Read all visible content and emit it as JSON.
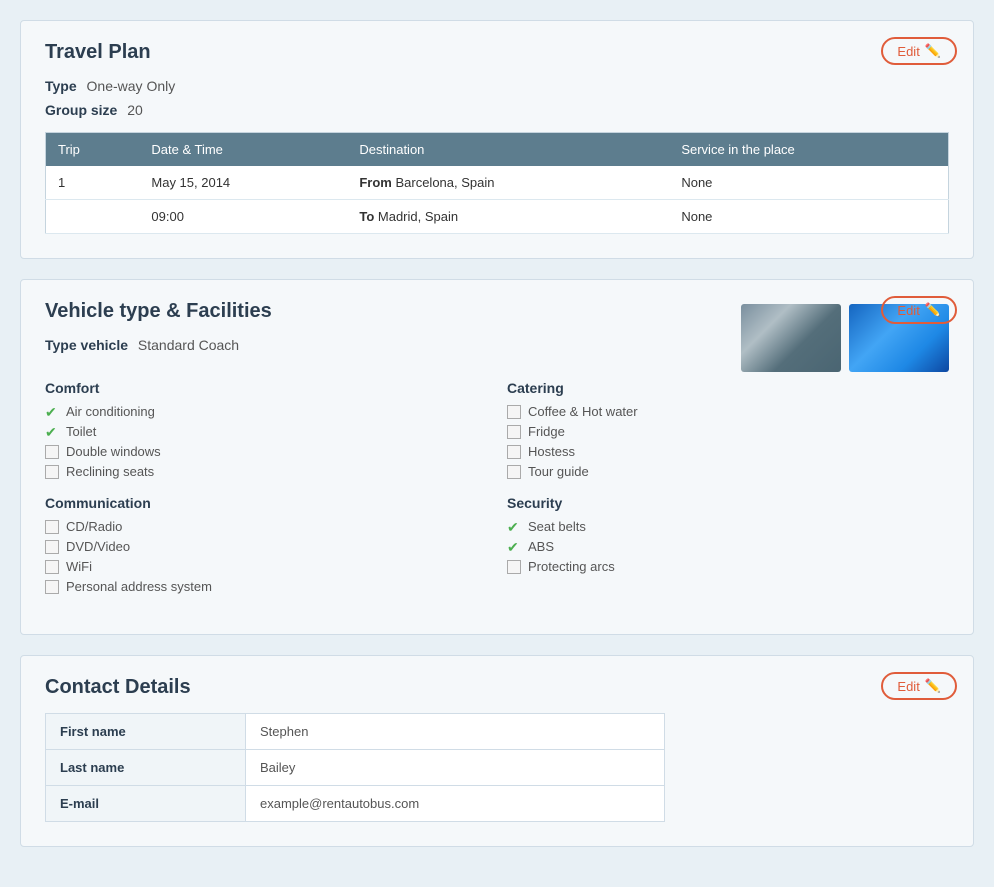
{
  "travelPlan": {
    "title": "Travel Plan",
    "editLabel": "Edit",
    "typeLabel": "Type",
    "typeValue": "One-way Only",
    "groupSizeLabel": "Group size",
    "groupSizeValue": "20",
    "table": {
      "headers": [
        "Trip",
        "Date & Time",
        "Destination",
        "Service in the place"
      ],
      "rows": [
        {
          "trip": "1",
          "dateTime": "May 15, 2014",
          "destinationFromLabel": "From",
          "destinationFrom": "Barcelona, Spain",
          "serviceFrom": "None"
        },
        {
          "trip": "",
          "dateTime": "09:00",
          "destinationToLabel": "To",
          "destinationTo": "Madrid, Spain",
          "serviceTo": "None"
        }
      ]
    }
  },
  "vehicleFacilities": {
    "title": "Vehicle type & Facilities",
    "editLabel": "Edit",
    "typeVehicleLabel": "Type vehicle",
    "typeVehicleValue": "Standard Coach",
    "comfort": {
      "title": "Comfort",
      "items": [
        {
          "label": "Air conditioning",
          "checked": true
        },
        {
          "label": "Toilet",
          "checked": true
        },
        {
          "label": "Double windows",
          "checked": false
        },
        {
          "label": "Reclining seats",
          "checked": false
        }
      ]
    },
    "communication": {
      "title": "Communication",
      "items": [
        {
          "label": "CD/Radio",
          "checked": false
        },
        {
          "label": "DVD/Video",
          "checked": false
        },
        {
          "label": "WiFi",
          "checked": false
        },
        {
          "label": "Personal address system",
          "checked": false
        }
      ]
    },
    "catering": {
      "title": "Catering",
      "items": [
        {
          "label": "Coffee & Hot water",
          "checked": false
        },
        {
          "label": "Fridge",
          "checked": false
        },
        {
          "label": "Hostess",
          "checked": false
        },
        {
          "label": "Tour guide",
          "checked": false
        }
      ]
    },
    "security": {
      "title": "Security",
      "items": [
        {
          "label": "Seat belts",
          "checked": true
        },
        {
          "label": "ABS",
          "checked": true
        },
        {
          "label": "Protecting arcs",
          "checked": false
        }
      ]
    }
  },
  "contactDetails": {
    "title": "Contact Details",
    "editLabel": "Edit",
    "fields": [
      {
        "label": "First name",
        "value": "Stephen"
      },
      {
        "label": "Last name",
        "value": "Bailey"
      },
      {
        "label": "E-mail",
        "value": "example@rentautobus.com"
      }
    ]
  }
}
